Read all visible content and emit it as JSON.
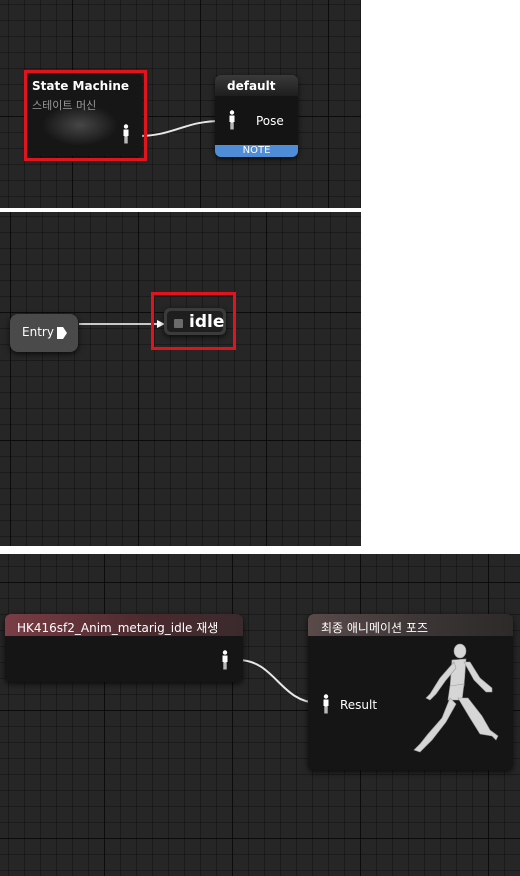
{
  "panel_state_machine": {
    "state_machine_node": {
      "title": "State Machine",
      "subtitle": "스테이트 머신"
    },
    "default_node": {
      "title": "default",
      "pin_label": "Pose",
      "note_label": "NOTE"
    }
  },
  "panel_states": {
    "entry_node": {
      "label": "Entry"
    },
    "idle_node": {
      "label": "idle"
    }
  },
  "panel_output": {
    "play_node": {
      "title": "HK416sf2_Anim_metarig_idle 재생"
    },
    "final_pose_node": {
      "title": "최종 애니메이션 포즈",
      "pin_label": "Result"
    }
  },
  "colors": {
    "highlight": "#e0141e",
    "note": "#4f8dd6",
    "grid_bg": "#262626"
  },
  "icons": [
    "pose-pin-icon",
    "entry-arrow-icon",
    "state-icon",
    "mannequin-preview-icon"
  ]
}
